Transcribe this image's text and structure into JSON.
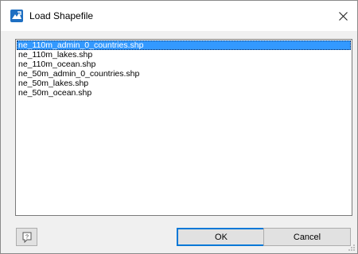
{
  "window": {
    "title": "Load Shapefile",
    "close_glyph": "close-icon",
    "app_icon": "shapefile-app-icon",
    "accent_color": "#0078d7"
  },
  "file_list": {
    "items": [
      {
        "label": "ne_110m_admin_0_countries.shp",
        "selected": true
      },
      {
        "label": "ne_110m_lakes.shp",
        "selected": false
      },
      {
        "label": "ne_110m_ocean.shp",
        "selected": false
      },
      {
        "label": "ne_50m_admin_0_countries.shp",
        "selected": false
      },
      {
        "label": "ne_50m_lakes.shp",
        "selected": false
      },
      {
        "label": "ne_50m_ocean.shp",
        "selected": false
      }
    ],
    "selection_color": "#3399ff"
  },
  "footer": {
    "help_icon": "help-icon",
    "ok_label": "OK",
    "cancel_label": "Cancel"
  }
}
